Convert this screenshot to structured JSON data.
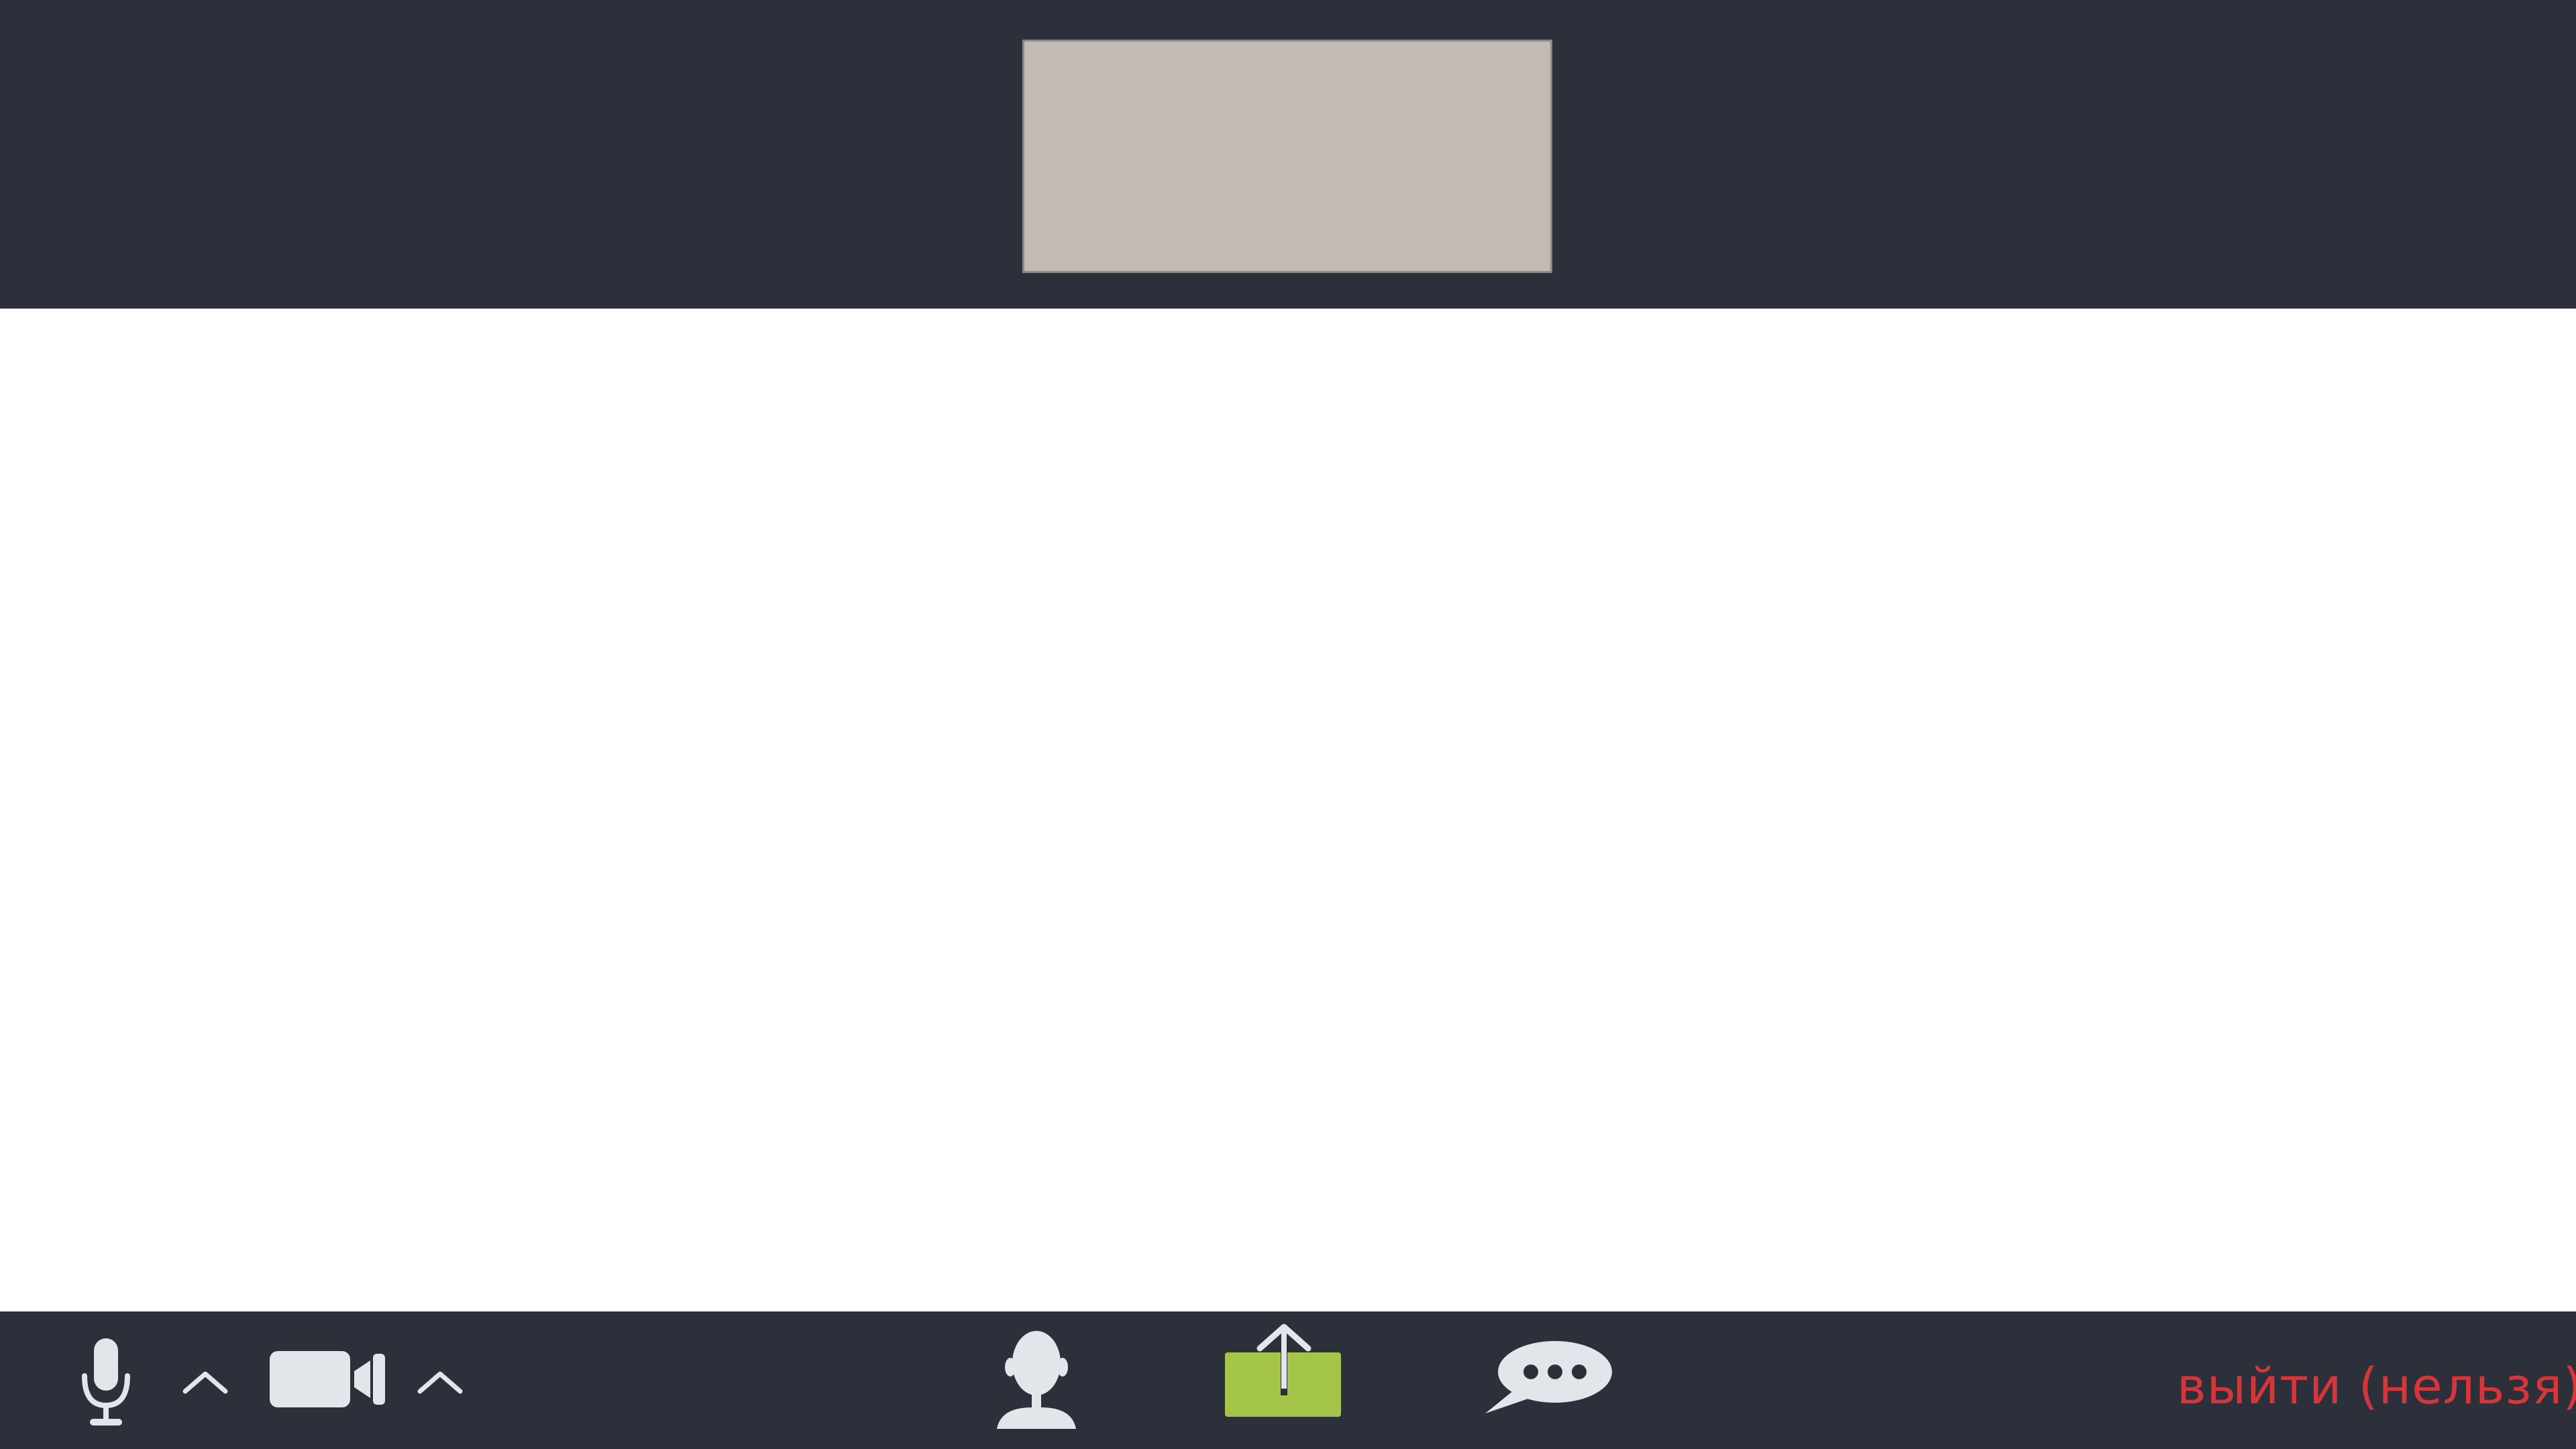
{
  "top_bar": {
    "speaker_tile": {
      "icon": "video-placeholder"
    }
  },
  "toolbar": {
    "mic": {
      "icon": "microphone-icon"
    },
    "mic_options": {
      "icon": "chevron-up-icon"
    },
    "camera": {
      "icon": "video-camera-icon"
    },
    "camera_options": {
      "icon": "chevron-up-icon"
    },
    "participants": {
      "icon": "participant-icon"
    },
    "share_screen": {
      "icon": "share-screen-icon",
      "color": "#a4c54a"
    },
    "chat": {
      "icon": "chat-bubble-icon"
    },
    "leave_label": "выйти (нельзя)",
    "leave_color": "#d6353a"
  },
  "colors": {
    "bar_background": "#2b303a",
    "tile_background": "#c3bab5",
    "icon": "#e2e6ea",
    "stage": "#ffffff"
  }
}
